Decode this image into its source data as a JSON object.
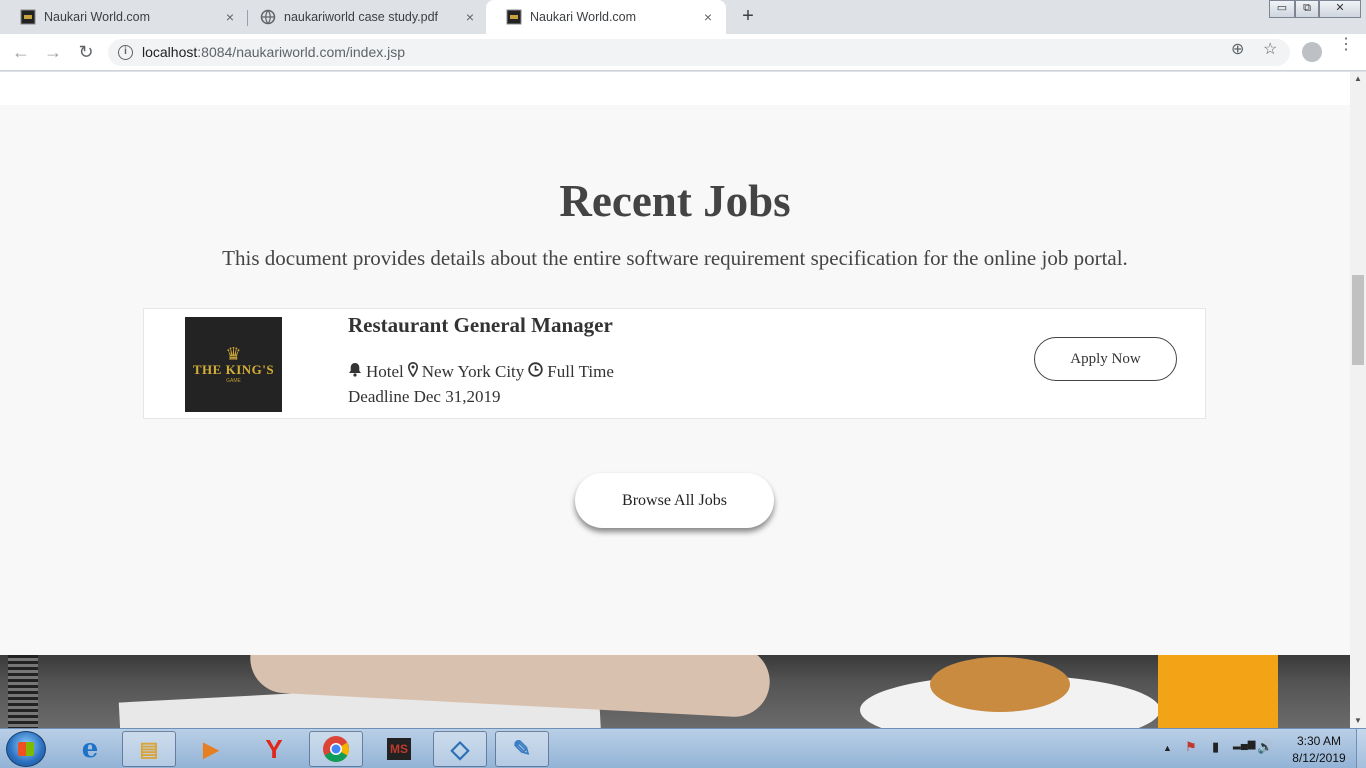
{
  "browser": {
    "tabs": [
      {
        "title": "Naukari World.com",
        "icon": "kings-logo-favicon",
        "active": false
      },
      {
        "title": "naukariworld case study.pdf",
        "icon": "globe-icon",
        "active": false
      },
      {
        "title": "Naukari World.com",
        "icon": "kings-logo-favicon",
        "active": true
      }
    ],
    "tab_close": "×",
    "new_tab": "+",
    "window_controls": {
      "minimize": "▭",
      "restore": "⧉",
      "close": "✕"
    },
    "nav": {
      "back": "←",
      "forward": "→",
      "reload": "↻"
    },
    "url_host": "localhost",
    "url_rest": ":8084/naukariworld.com/index.jsp",
    "info_icon": "i",
    "zoom_icon": "⊕",
    "star_icon": "☆",
    "menu_icon": "⋮"
  },
  "page": {
    "section_title": "Recent Jobs",
    "section_subtitle": "This document provides details about the entire software requirement specification for the online job portal.",
    "job": {
      "logo_crown": "♛",
      "logo_text": "THE KING'S",
      "logo_sub": "GAME",
      "title": "Restaurant General Manager",
      "category_icon": "🔔",
      "category": "Hotel",
      "location_icon": "📍",
      "location": "New York City",
      "type_icon": "◷",
      "type": "Full Time",
      "deadline": "Deadline Dec 31,2019",
      "apply_label": "Apply Now"
    },
    "browse_label": "Browse All Jobs"
  },
  "scrollbar": {
    "up": "▲",
    "down": "▼"
  },
  "taskbar": {
    "apps": [
      {
        "name": "internet-explorer",
        "glyph": "e",
        "color": "#1e73c8"
      },
      {
        "name": "file-explorer",
        "glyph": "▤",
        "color": "#d9a43a"
      },
      {
        "name": "media-player",
        "glyph": "▶",
        "color": "#e67e22"
      },
      {
        "name": "yandex-browser",
        "glyph": "Y",
        "color": "#e1261c"
      },
      {
        "name": "chrome",
        "glyph": "◉",
        "color": "#2a8f3c"
      },
      {
        "name": "ms-office",
        "glyph": "MS",
        "color": "#c0392b"
      },
      {
        "name": "virtualbox",
        "glyph": "◇",
        "color": "#2c6fb5"
      },
      {
        "name": "paint",
        "glyph": "✎",
        "color": "#3a7dc2"
      }
    ],
    "tray_expand": "▲",
    "tray_flag": "⚑",
    "tray_battery": "▮",
    "tray_signal": "▂▄▆",
    "tray_volume": "🔊",
    "time": "3:30 AM",
    "date": "8/12/2019"
  }
}
